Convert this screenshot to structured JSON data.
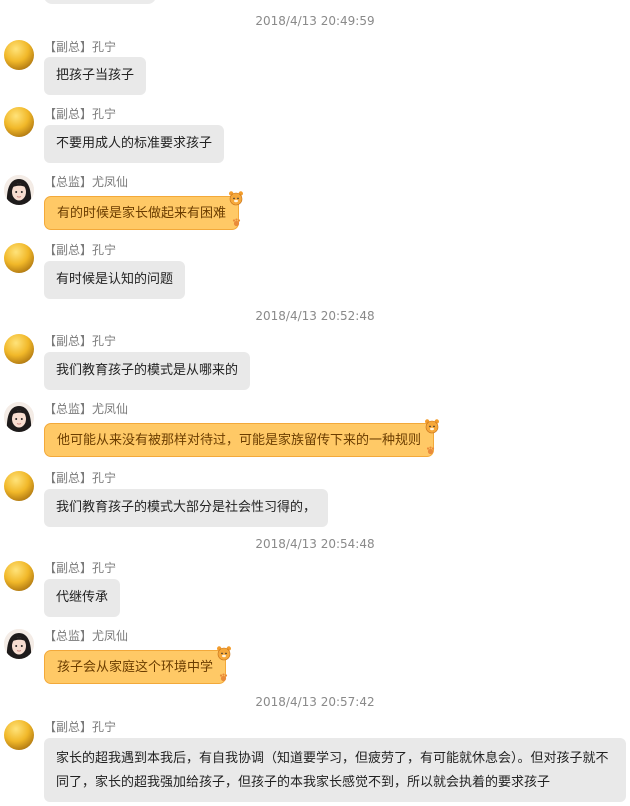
{
  "messages": [
    {
      "type": "time",
      "text": "2018/4/13 20:49:59"
    },
    {
      "type": "msg",
      "sender": "【副总】孔宁",
      "text": "把孩子当孩子",
      "avatar": "avatar-kong-icon"
    },
    {
      "type": "msg",
      "sender": "【副总】孔宁",
      "text": "不要用成人的标准要求孩子",
      "avatar": "avatar-kong-icon"
    },
    {
      "type": "msg",
      "sender": "【总监】尤凤仙",
      "text": "有的时候是家长做起来有困难",
      "avatar": "avatar-you-icon",
      "style": "orange"
    },
    {
      "type": "msg",
      "sender": "【副总】孔宁",
      "text": "有时候是认知的问题",
      "avatar": "avatar-kong-icon"
    },
    {
      "type": "time",
      "text": "2018/4/13 20:52:48"
    },
    {
      "type": "msg",
      "sender": "【副总】孔宁",
      "text": "我们教育孩子的模式是从哪来的",
      "avatar": "avatar-kong-icon"
    },
    {
      "type": "msg",
      "sender": "【总监】尤凤仙",
      "text": "他可能从来没有被那样对待过，可能是家族留传下来的一种规则",
      "avatar": "avatar-you-icon",
      "style": "orange"
    },
    {
      "type": "msg",
      "sender": "【副总】孔宁",
      "text": "我们教育孩子的模式大部分是社会性习得的，",
      "avatar": "avatar-kong-icon"
    },
    {
      "type": "time",
      "text": "2018/4/13 20:54:48"
    },
    {
      "type": "msg",
      "sender": "【副总】孔宁",
      "text": "代继传承",
      "avatar": "avatar-kong-icon"
    },
    {
      "type": "msg",
      "sender": "【总监】尤凤仙",
      "text": "孩子会从家庭这个环境中学",
      "avatar": "avatar-you-icon",
      "style": "orange"
    },
    {
      "type": "time",
      "text": "2018/4/13 20:57:42"
    },
    {
      "type": "msg",
      "sender": "【副总】孔宁",
      "text": "家长的超我遇到本我后，有自我协调（知道要学习，但疲劳了，有可能就休息会）。但对孩子就不同了，家长的超我强加给孩子，但孩子的本我家长感觉不到，所以就会执着的要求孩子",
      "avatar": "avatar-kong-icon",
      "style": "long"
    }
  ],
  "colors": {
    "gray_bubble": "#e9e9e9",
    "orange_bubble": "#ffc966",
    "orange_border": "#f3a93a",
    "timestamp": "#8a8a8a"
  }
}
